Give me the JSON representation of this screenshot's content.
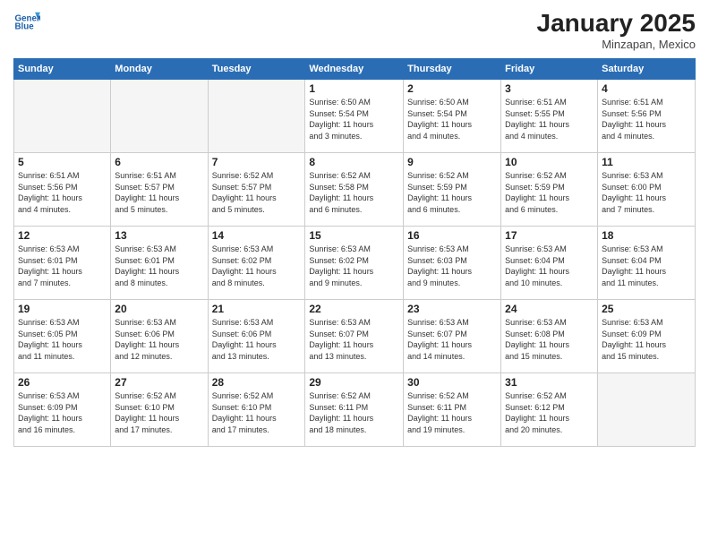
{
  "header": {
    "logo_line1": "General",
    "logo_line2": "Blue",
    "month": "January 2025",
    "location": "Minzapan, Mexico"
  },
  "days_of_week": [
    "Sunday",
    "Monday",
    "Tuesday",
    "Wednesday",
    "Thursday",
    "Friday",
    "Saturday"
  ],
  "weeks": [
    [
      {
        "num": "",
        "info": ""
      },
      {
        "num": "",
        "info": ""
      },
      {
        "num": "",
        "info": ""
      },
      {
        "num": "1",
        "info": "Sunrise: 6:50 AM\nSunset: 5:54 PM\nDaylight: 11 hours\nand 3 minutes."
      },
      {
        "num": "2",
        "info": "Sunrise: 6:50 AM\nSunset: 5:54 PM\nDaylight: 11 hours\nand 4 minutes."
      },
      {
        "num": "3",
        "info": "Sunrise: 6:51 AM\nSunset: 5:55 PM\nDaylight: 11 hours\nand 4 minutes."
      },
      {
        "num": "4",
        "info": "Sunrise: 6:51 AM\nSunset: 5:56 PM\nDaylight: 11 hours\nand 4 minutes."
      }
    ],
    [
      {
        "num": "5",
        "info": "Sunrise: 6:51 AM\nSunset: 5:56 PM\nDaylight: 11 hours\nand 4 minutes."
      },
      {
        "num": "6",
        "info": "Sunrise: 6:51 AM\nSunset: 5:57 PM\nDaylight: 11 hours\nand 5 minutes."
      },
      {
        "num": "7",
        "info": "Sunrise: 6:52 AM\nSunset: 5:57 PM\nDaylight: 11 hours\nand 5 minutes."
      },
      {
        "num": "8",
        "info": "Sunrise: 6:52 AM\nSunset: 5:58 PM\nDaylight: 11 hours\nand 6 minutes."
      },
      {
        "num": "9",
        "info": "Sunrise: 6:52 AM\nSunset: 5:59 PM\nDaylight: 11 hours\nand 6 minutes."
      },
      {
        "num": "10",
        "info": "Sunrise: 6:52 AM\nSunset: 5:59 PM\nDaylight: 11 hours\nand 6 minutes."
      },
      {
        "num": "11",
        "info": "Sunrise: 6:53 AM\nSunset: 6:00 PM\nDaylight: 11 hours\nand 7 minutes."
      }
    ],
    [
      {
        "num": "12",
        "info": "Sunrise: 6:53 AM\nSunset: 6:01 PM\nDaylight: 11 hours\nand 7 minutes."
      },
      {
        "num": "13",
        "info": "Sunrise: 6:53 AM\nSunset: 6:01 PM\nDaylight: 11 hours\nand 8 minutes."
      },
      {
        "num": "14",
        "info": "Sunrise: 6:53 AM\nSunset: 6:02 PM\nDaylight: 11 hours\nand 8 minutes."
      },
      {
        "num": "15",
        "info": "Sunrise: 6:53 AM\nSunset: 6:02 PM\nDaylight: 11 hours\nand 9 minutes."
      },
      {
        "num": "16",
        "info": "Sunrise: 6:53 AM\nSunset: 6:03 PM\nDaylight: 11 hours\nand 9 minutes."
      },
      {
        "num": "17",
        "info": "Sunrise: 6:53 AM\nSunset: 6:04 PM\nDaylight: 11 hours\nand 10 minutes."
      },
      {
        "num": "18",
        "info": "Sunrise: 6:53 AM\nSunset: 6:04 PM\nDaylight: 11 hours\nand 11 minutes."
      }
    ],
    [
      {
        "num": "19",
        "info": "Sunrise: 6:53 AM\nSunset: 6:05 PM\nDaylight: 11 hours\nand 11 minutes."
      },
      {
        "num": "20",
        "info": "Sunrise: 6:53 AM\nSunset: 6:06 PM\nDaylight: 11 hours\nand 12 minutes."
      },
      {
        "num": "21",
        "info": "Sunrise: 6:53 AM\nSunset: 6:06 PM\nDaylight: 11 hours\nand 13 minutes."
      },
      {
        "num": "22",
        "info": "Sunrise: 6:53 AM\nSunset: 6:07 PM\nDaylight: 11 hours\nand 13 minutes."
      },
      {
        "num": "23",
        "info": "Sunrise: 6:53 AM\nSunset: 6:07 PM\nDaylight: 11 hours\nand 14 minutes."
      },
      {
        "num": "24",
        "info": "Sunrise: 6:53 AM\nSunset: 6:08 PM\nDaylight: 11 hours\nand 15 minutes."
      },
      {
        "num": "25",
        "info": "Sunrise: 6:53 AM\nSunset: 6:09 PM\nDaylight: 11 hours\nand 15 minutes."
      }
    ],
    [
      {
        "num": "26",
        "info": "Sunrise: 6:53 AM\nSunset: 6:09 PM\nDaylight: 11 hours\nand 16 minutes."
      },
      {
        "num": "27",
        "info": "Sunrise: 6:52 AM\nSunset: 6:10 PM\nDaylight: 11 hours\nand 17 minutes."
      },
      {
        "num": "28",
        "info": "Sunrise: 6:52 AM\nSunset: 6:10 PM\nDaylight: 11 hours\nand 17 minutes."
      },
      {
        "num": "29",
        "info": "Sunrise: 6:52 AM\nSunset: 6:11 PM\nDaylight: 11 hours\nand 18 minutes."
      },
      {
        "num": "30",
        "info": "Sunrise: 6:52 AM\nSunset: 6:11 PM\nDaylight: 11 hours\nand 19 minutes."
      },
      {
        "num": "31",
        "info": "Sunrise: 6:52 AM\nSunset: 6:12 PM\nDaylight: 11 hours\nand 20 minutes."
      },
      {
        "num": "",
        "info": ""
      }
    ]
  ]
}
